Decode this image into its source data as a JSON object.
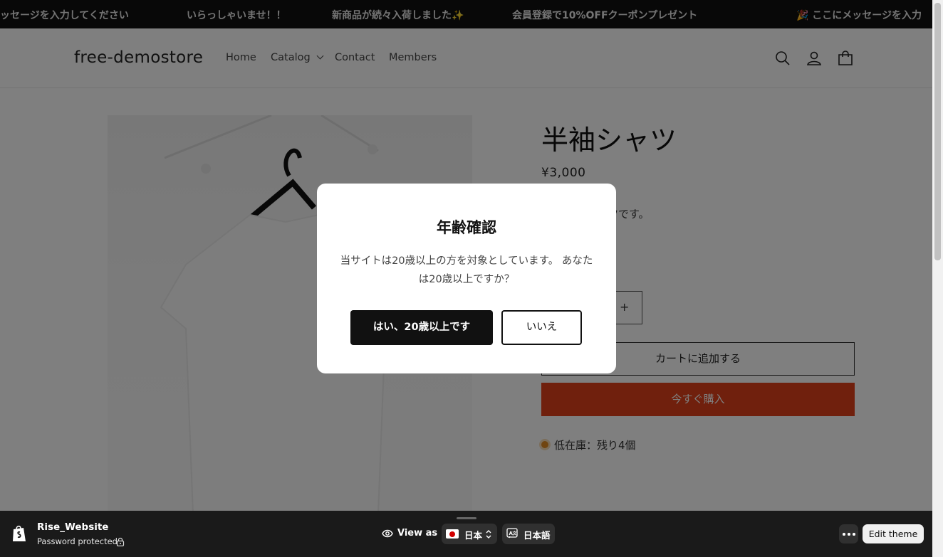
{
  "announcement": {
    "messages": [
      "ッセージを入力してください",
      "いらっしゃいませ！！",
      "新商品が続々入荷しました✨",
      "会員登録で10%OFFクーポンプレゼント",
      "🎉 ここにメッセージを入力"
    ]
  },
  "header": {
    "logo": "free-demostore",
    "nav": [
      "Home",
      "Catalog",
      "Contact",
      "Members"
    ],
    "icons": [
      "search-icon",
      "account-icon",
      "cart-icon"
    ]
  },
  "product": {
    "title": "半袖シャツ",
    "price": "¥3,000",
    "description_visible": "ャツです。",
    "qty_plus": "+",
    "add_to_cart": "カートに追加する",
    "buy_now": "今すぐ購入",
    "stock": "低在庫：残り4個",
    "buy_color": "#e0401a"
  },
  "modal": {
    "title": "年齢確認",
    "text": "当サイトは20歳以上の方を対象としています。 あなたは20歳以上ですか？",
    "yes": "はい、20歳以上です",
    "no": "いいえ"
  },
  "bottombar": {
    "site_name": "Rise_Website",
    "status": "Password protected",
    "view_as": "View as",
    "country": "日本",
    "language": "日本語",
    "edit_theme": "Edit theme"
  }
}
